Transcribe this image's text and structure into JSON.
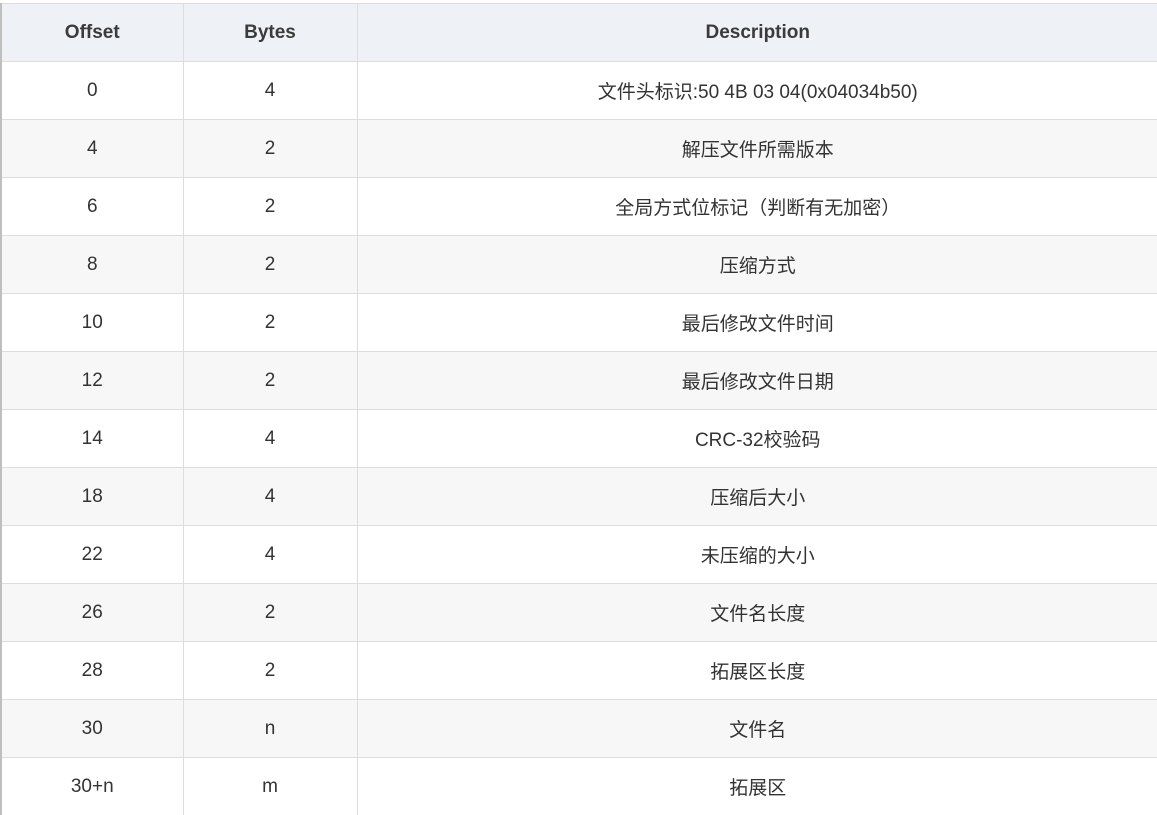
{
  "table": {
    "headers": [
      "Offset",
      "Bytes",
      "Description"
    ],
    "rows": [
      [
        "0",
        "4",
        "文件头标识:50 4B 03 04(0x04034b50)"
      ],
      [
        "4",
        "2",
        "解压文件所需版本"
      ],
      [
        "6",
        "2",
        "全局方式位标记（判断有无加密）"
      ],
      [
        "8",
        "2",
        "压缩方式"
      ],
      [
        "10",
        "2",
        "最后修改文件时间"
      ],
      [
        "12",
        "2",
        "最后修改文件日期"
      ],
      [
        "14",
        "4",
        "CRC-32校验码"
      ],
      [
        "18",
        "4",
        "压缩后大小"
      ],
      [
        "22",
        "4",
        "未压缩的大小"
      ],
      [
        "26",
        "2",
        "文件名长度"
      ],
      [
        "28",
        "2",
        "拓展区长度"
      ],
      [
        "30",
        "n",
        "文件名"
      ],
      [
        "30+n",
        "m",
        "拓展区"
      ]
    ]
  }
}
